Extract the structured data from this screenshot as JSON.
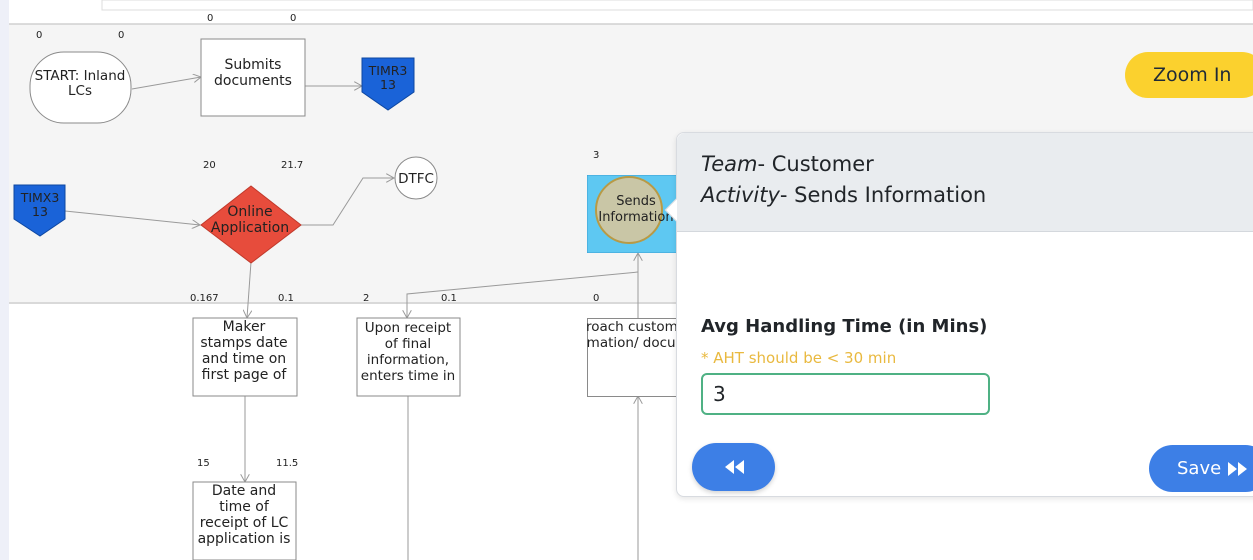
{
  "nodes": {
    "start": "START: Inland LCs",
    "submits": "Submits documents",
    "timr": "TIMR3 13",
    "timx": "TIMX3 13",
    "online": "Online Application",
    "dtfc": "DTFC",
    "sends": "Sends Information",
    "maker": "Maker stamps date and time on first page of",
    "upon": "Upon receipt of final information, enters time in",
    "approach": "Approach customer for information/ documents",
    "date": "Date and time of receipt of LC application is"
  },
  "metrics": {
    "top_a": "0",
    "top_b": "0",
    "start_a": "0",
    "start_b": "0",
    "online_a": "20",
    "online_b": "21.7",
    "sends_a": "3",
    "maker_a": "0.167",
    "maker_b": "0.1",
    "upon_a": "2",
    "upon_b": "0.1",
    "approach_a": "0",
    "date_a": "15",
    "date_b": "11.5"
  },
  "toolbar": {
    "zoom_in_label": "Zoom In"
  },
  "panel": {
    "team_label": "Team",
    "team_value": "- Customer",
    "activity_label": "Activity",
    "activity_value": "- Sends Information",
    "aht_label": "Avg Handling Time (in Mins)",
    "aht_hint": "* AHT should be < 30 min",
    "aht_value": "3",
    "save_label": "Save"
  },
  "colors": {
    "accent": "#3d7fe6",
    "zoom": "#fbd12e",
    "decision": "#e74c3c",
    "timer": "#1a63d8",
    "selected": "#5ec8f2"
  }
}
